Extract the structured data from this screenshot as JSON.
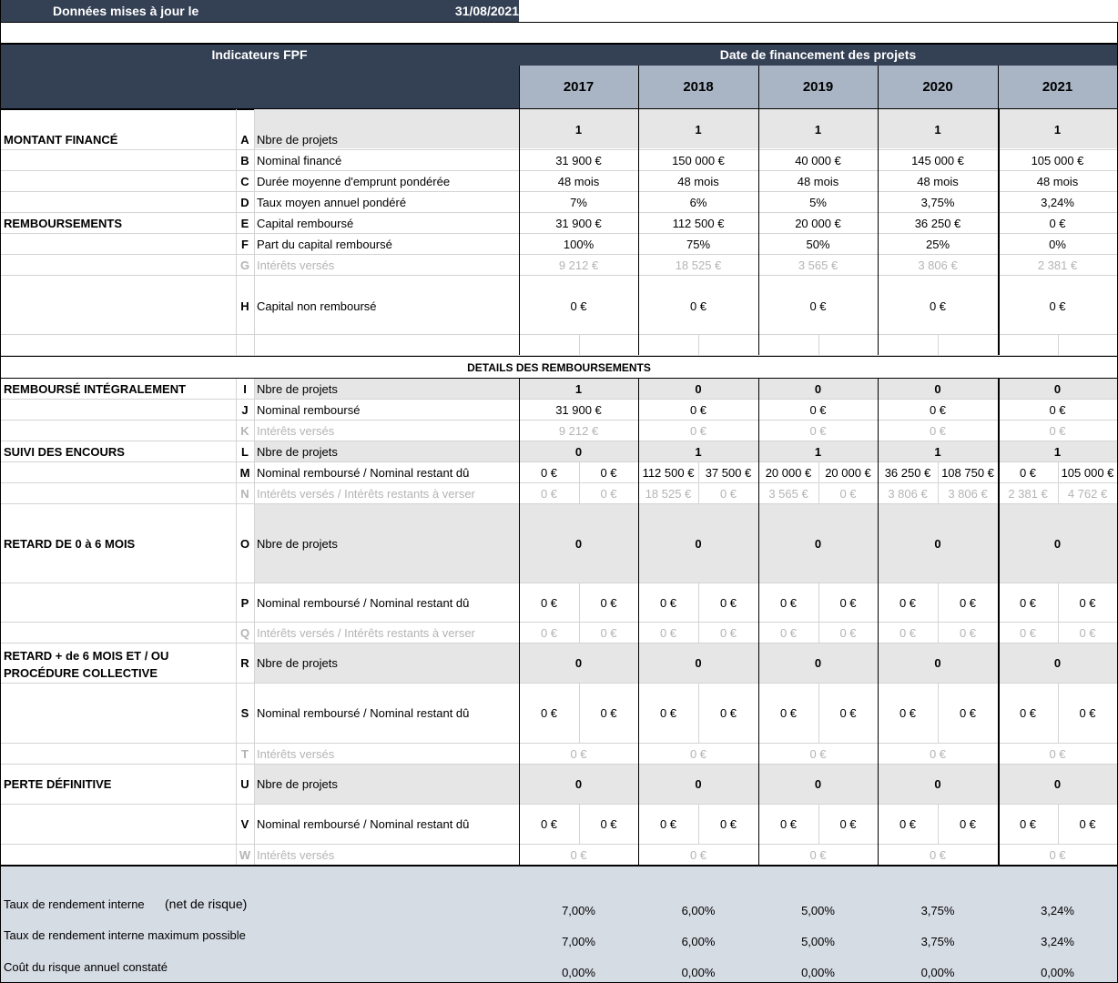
{
  "header": {
    "updated_label": "Données mises à jour le",
    "updated_date": "31/08/2021",
    "indicators_label": "Indicateurs FPF",
    "date_label": "Date de financement des projets",
    "years": [
      "2017",
      "2018",
      "2019",
      "2020",
      "2021"
    ]
  },
  "sections": {
    "montant": "MONTANT FINANCÉ",
    "remboursements": "REMBOURSEMENTS",
    "details": "DETAILS DES REMBOURSEMENTS",
    "rembourse_int": "REMBOURSÉ INTÉGRALEMENT",
    "suivi": "SUIVI DES ENCOURS",
    "retard06": "RETARD DE 0 à 6 MOIS",
    "retard6_l1": "RETARD + de 6 MOIS ET / OU",
    "retard6_l2": "PROCÉDURE COLLECTIVE",
    "perte": "PERTE DÉFINITIVE"
  },
  "rows": {
    "A": {
      "letter": "A",
      "label": "Nbre de projets",
      "values": [
        "1",
        "1",
        "1",
        "1",
        "1"
      ]
    },
    "B": {
      "letter": "B",
      "label": "Nominal financé",
      "values": [
        "31 900 €",
        "150 000 €",
        "40 000 €",
        "145 000 €",
        "105 000 €"
      ]
    },
    "C": {
      "letter": "C",
      "label": "Durée moyenne d'emprunt pondérée",
      "values": [
        "48 mois",
        "48 mois",
        "48 mois",
        "48 mois",
        "48 mois"
      ]
    },
    "D": {
      "letter": "D",
      "label": "Taux moyen annuel pondéré",
      "values": [
        "7%",
        "6%",
        "5%",
        "3,75%",
        "3,24%"
      ]
    },
    "E": {
      "letter": "E",
      "label": "Capital remboursé",
      "values": [
        "31 900 €",
        "112 500 €",
        "20 000 €",
        "36 250 €",
        "0 €"
      ]
    },
    "F": {
      "letter": "F",
      "label": "Part du capital remboursé",
      "values": [
        "100%",
        "75%",
        "50%",
        "25%",
        "0%"
      ]
    },
    "G": {
      "letter": "G",
      "label": "Intérêts versés",
      "values": [
        "9 212 €",
        "18 525 €",
        "3 565 €",
        "3 806 €",
        "2 381 €"
      ]
    },
    "H": {
      "letter": "H",
      "label": "Capital non remboursé",
      "values": [
        "0 €",
        "0 €",
        "0 €",
        "0 €",
        "0 €"
      ]
    },
    "I": {
      "letter": "I",
      "label": "Nbre de projets",
      "values": [
        "1",
        "0",
        "0",
        "0",
        "0"
      ]
    },
    "J": {
      "letter": "J",
      "label": "Nominal remboursé",
      "values": [
        "31 900 €",
        "0 €",
        "0 €",
        "0 €",
        "0 €"
      ]
    },
    "K": {
      "letter": "K",
      "label": "Intérêts versés",
      "values": [
        "9 212 €",
        "0 €",
        "0 €",
        "0 €",
        "0 €"
      ]
    },
    "L": {
      "letter": "L",
      "label": "Nbre de projets",
      "values": [
        "0",
        "1",
        "1",
        "1",
        "1"
      ]
    },
    "M": {
      "letter": "M",
      "label": "Nominal remboursé / Nominal restant dû",
      "values": [
        "0 €",
        "0 €",
        "112 500 €",
        "37 500 €",
        "20 000 €",
        "20 000 €",
        "36 250 €",
        "108 750 €",
        "0 €",
        "105 000 €"
      ]
    },
    "N": {
      "letter": "N",
      "label": "Intérêts versés / Intérêts restants à verser",
      "values": [
        "0 €",
        "0 €",
        "18 525 €",
        "0 €",
        "3 565 €",
        "0 €",
        "3 806 €",
        "3 806 €",
        "2 381 €",
        "4 762 €"
      ]
    },
    "O": {
      "letter": "O",
      "label": "Nbre de projets",
      "values": [
        "0",
        "0",
        "0",
        "0",
        "0"
      ]
    },
    "P": {
      "letter": "P",
      "label": "Nominal remboursé / Nominal restant dû",
      "values": [
        "0 €",
        "0 €",
        "0 €",
        "0 €",
        "0 €",
        "0 €",
        "0 €",
        "0 €",
        "0 €",
        "0 €"
      ]
    },
    "Q": {
      "letter": "Q",
      "label": "Intérêts versés / Intérêts restants à verser",
      "values": [
        "0 €",
        "0 €",
        "0 €",
        "0 €",
        "0 €",
        "0 €",
        "0 €",
        "0 €",
        "0 €",
        "0 €"
      ]
    },
    "R": {
      "letter": "R",
      "label": "Nbre de projets",
      "values": [
        "0",
        "0",
        "0",
        "0",
        "0"
      ]
    },
    "S": {
      "letter": "S",
      "label": "Nominal remboursé / Nominal restant dû",
      "values": [
        "0 €",
        "0 €",
        "0 €",
        "0 €",
        "0 €",
        "0 €",
        "0 €",
        "0 €",
        "0 €",
        "0 €"
      ]
    },
    "T": {
      "letter": "T",
      "label": "Intérêts versés",
      "values": [
        "0 €",
        "0 €",
        "0 €",
        "0 €",
        "0 €"
      ]
    },
    "U": {
      "letter": "U",
      "label": "Nbre de projets",
      "values": [
        "0",
        "0",
        "0",
        "0",
        "0"
      ]
    },
    "V": {
      "letter": "V",
      "label": "Nominal remboursé / Nominal restant dû",
      "values": [
        "0 €",
        "0 €",
        "0 €",
        "0 €",
        "0 €",
        "0 €",
        "0 €",
        "0 €",
        "0 €",
        "0 €"
      ]
    },
    "W": {
      "letter": "W",
      "label": "Intérêts versés",
      "values": [
        "0 €",
        "0 €",
        "0 €",
        "0 €",
        "0 €"
      ]
    }
  },
  "footer": {
    "tri_net_label": "Taux de rendement interne",
    "tri_net_suffix": "(net de risque)",
    "tri_net_values": [
      "7,00%",
      "6,00%",
      "5,00%",
      "3,75%",
      "3,24%"
    ],
    "tri_max_label": "Taux de rendement interne maximum possible",
    "tri_max_values": [
      "7,00%",
      "6,00%",
      "5,00%",
      "3,75%",
      "3,24%"
    ],
    "cout_label": "Coût du risque annuel constaté",
    "cout_values": [
      "0,00%",
      "0,00%",
      "0,00%",
      "0,00%",
      "0,00%"
    ]
  },
  "colors": {
    "header_dark": "#344054",
    "header_light": "#a9b5c5",
    "row_grey": "#e6e6e6",
    "muted_text": "#b4b4b4",
    "footer_bg": "#d6dce4"
  }
}
